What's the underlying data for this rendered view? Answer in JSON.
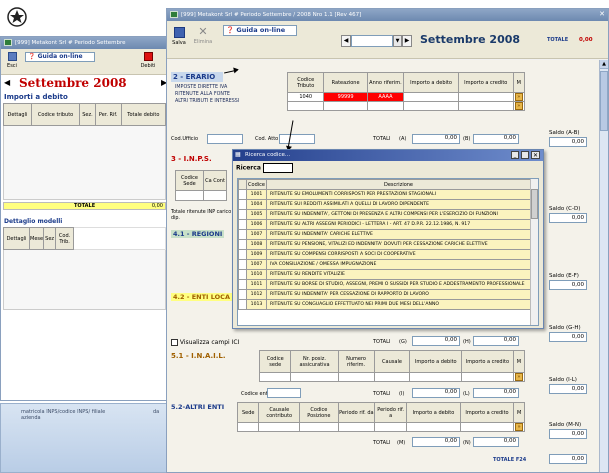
{
  "logo": {
    "icon": "emblem-icon"
  },
  "left_window": {
    "title": "[999] Metakont Srl # Periodo Settembre",
    "toolbar": {
      "exit_label": "Esci",
      "guide_label": "Guida on-line",
      "debts_label": "Debiti"
    },
    "month": "Settembre 2008",
    "section_title": "Importi a debito",
    "columns": [
      "Dettagli",
      "Codice tributo",
      "Sez.",
      "Per. Rif.",
      "Totale debito"
    ],
    "totale_label": "TOTALE",
    "totale_value": "0,00",
    "details_title": "Dettaglio modelli",
    "details_columns": [
      "Dettagli",
      "Mese",
      "Sez",
      "Cod. Trib."
    ],
    "footer_text": "matricola INPS/codice INPS/ filiale azienda",
    "footer_col": "da"
  },
  "main_window": {
    "title": "[999] Metakont Srl # Periodo Settembre / 2008 Nro 1.1 [Rev 467]",
    "toolbar": {
      "save_label": "Salva",
      "delete_label": "Elimina",
      "guide_label": "Guida on-line",
      "month": "Settembre 2008",
      "totale_label": "TOTALE",
      "totale_value": "0,00"
    },
    "erario": {
      "title": "2 - ERARIO",
      "lines": [
        "IMPOSTE DIRETTE   IVA",
        "RITENUTE ALLA FONTE",
        "ALTRI TRIBUTI E INTERESSI"
      ],
      "columns": [
        "Codice Tributo",
        "Rateazione",
        "Anno riferim.",
        "Importo a debito",
        "Importo a credito",
        "M"
      ],
      "row": {
        "codice": "1040",
        "rateazione": "99999",
        "anno": "AAAA"
      },
      "cod_ufficio_label": "Cod.Ufficio",
      "cod_atto_label": "Cod. Atto",
      "totali_label": "TOTALI",
      "totali_a": "(A)",
      "totali_a_value": "0,00",
      "totali_b": "(B)",
      "totali_b_value": "0,00",
      "saldo_label": "Saldo (A-B)",
      "saldo_value": "0,00"
    },
    "inps": {
      "title": "3 - I.N.P.S.",
      "columns": [
        "Codice Sede",
        "Ca Cont"
      ],
      "note": "Totale ritenute INP carico dip.",
      "saldo_label": "Saldo (C-D)",
      "saldo_value": "0,00"
    },
    "regioni": {
      "title": "4.1 - REGIONI",
      "saldo_label": "Saldo (E-F)",
      "saldo_value": "0,00"
    },
    "enti_locali": {
      "title": "4.2 - ENTI LOCA",
      "saldo_label": "Saldo (G-H)",
      "saldo_value": "0,00"
    },
    "visualizza_label": "Visualizza campi ICI",
    "visualizza_totali": {
      "label": "TOTALI",
      "g": "(G)",
      "g_value": "0,00",
      "h": "(H)",
      "h_value": "0,00"
    },
    "inail": {
      "title": "5.1 - I.N.A.I.L.",
      "columns": [
        "Codice sede",
        "Nr. posiz. assicurativa",
        "Numero riferim.",
        "Causale",
        "Importo a debito",
        "Importo a credito",
        "M"
      ],
      "codice_ente_label": "Codice ente",
      "totali_label": "TOTALI",
      "i": "(I)",
      "i_value": "0,00",
      "l": "(L)",
      "l_value": "0,00",
      "saldo_label": "Saldo (I-L)",
      "saldo_value": "0,00"
    },
    "altri_enti": {
      "title": "5.2-ALTRI ENTI",
      "columns": [
        "Sede",
        "Causale contributo",
        "Codice Posizione",
        "Periodo rif. da",
        "Periodo rif. a",
        "Importo a debito",
        "Importo a credito",
        "M"
      ],
      "totali_label": "TOTALI",
      "m": "(M)",
      "m_value": "0,00",
      "n": "(N)",
      "n_value": "0,00",
      "saldo_label": "Saldo (M-N)",
      "saldo_value": "0,00"
    },
    "totale_f24_label": "TOTALE F24",
    "totale_f24_value": "0,00"
  },
  "ricerca_dialog": {
    "title": "Ricerca codice...",
    "search_label": "Ricerca",
    "columns": [
      "Codice",
      "Descrizione"
    ],
    "rows": [
      {
        "code": "1001",
        "desc": "RITENUTE SU EMOLUMENTI CORRISPOSTI PER PRESTAZIONI STAGIONALI"
      },
      {
        "code": "1004",
        "desc": "RITENUTE SUI REDDITI ASSIMILATI A QUELLI DI LAVORO DIPENDENTE"
      },
      {
        "code": "1005",
        "desc": "RITENUTE SU INDENNITA', GETTONI DI PRESENZA E ALTRI COMPENSI PER L'ESERCIZIO DI FUNZIONI"
      },
      {
        "code": "1006",
        "desc": "RITENUTE SU ALTRI ASSEGNI PERIODICI - LETTERA I - ART. 47 D.P.R. 22.12.1986, N. 917"
      },
      {
        "code": "1007",
        "desc": "RITENUTE SU INDENNITA' CARICHE ELETTIVE"
      },
      {
        "code": "1008",
        "desc": "RITENUTE SU PENSIONE, VITALIZI ED INDENNITA' DOVUTI PER CESSAZIONE CARICHE ELETTIVE"
      },
      {
        "code": "1009",
        "desc": "RITENUTE SU COMPENSI CORRISPOSTI A SOCI DI COOPERATIVE"
      },
      {
        "code": "1007",
        "desc": "IVA CONSILIAZIONE / OMESSA IMPUGNAZIONE"
      },
      {
        "code": "1010",
        "desc": "RITENUTE SU RENDITE VITALIZIE"
      },
      {
        "code": "1011",
        "desc": "RITENUTE SU BORSE DI STUDIO, ASSEGNI, PREMI O SUSSIDI PER STUDIO E ADDESTRAMENTO PROFESSIONALE"
      },
      {
        "code": "1012",
        "desc": "RITENUTE SU INDENNITA' PER CESSAZIONE DI RAPPORTO DI LAVORO"
      },
      {
        "code": "1013",
        "desc": "RITENUTE SU CONGUAGLIO EFFETTUATO NEI PRIMI DUE MESI DELL'ANNO"
      }
    ]
  },
  "colors": {
    "accent_red": "#c00000",
    "title_blue": "#1a3a8a",
    "highlight_yellow": "#fbf3bf",
    "cell_red": "#ff0000"
  }
}
